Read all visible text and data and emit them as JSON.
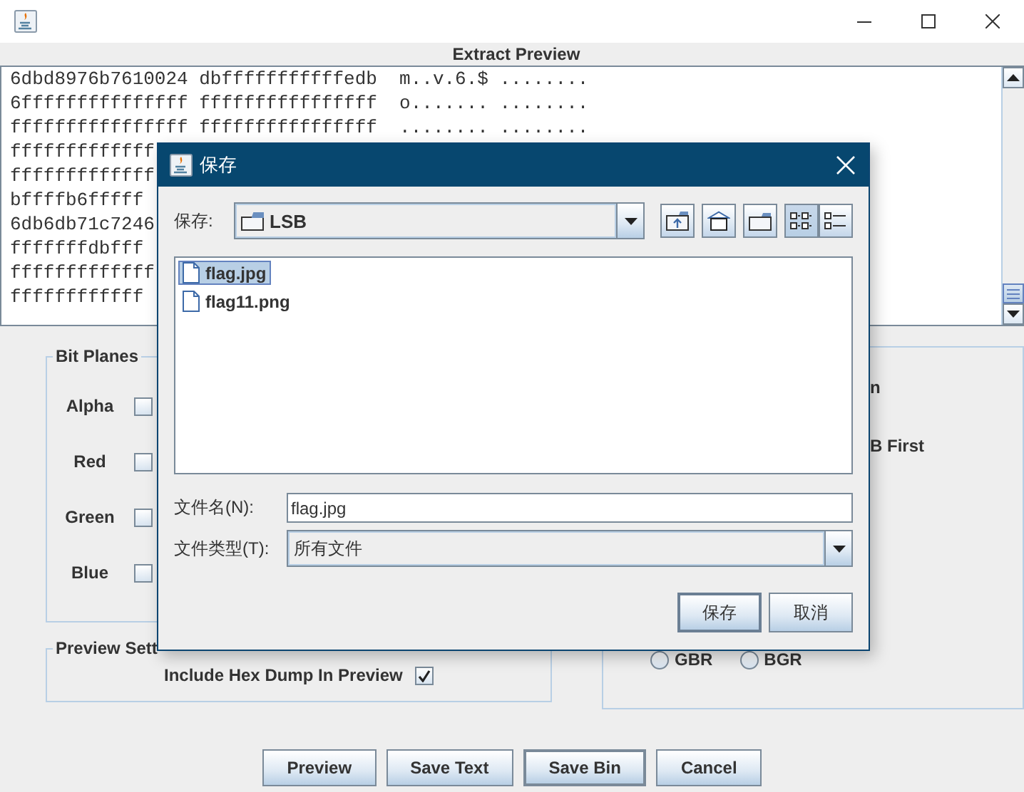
{
  "preview": {
    "title": "Extract Preview",
    "lines": [
      "6dbd8976b7610024 dbfffffffffffedb  m..v.6.$ ........",
      "6fffffffffffffff ffffffffffffffff  o....... ........",
      "ffffffffffffffff ffffffffffffffff  ........ ........",
      "fffffffffffff",
      "fffffffffffff",
      "bffffb6fffff",
      "6db6db71c7246",
      "fffffffdbfff",
      "fffffffffffff",
      "ffffffffffff"
    ]
  },
  "bit_planes": {
    "title": "Bit Planes",
    "rows": [
      {
        "label": "Alpha",
        "checked": false
      },
      {
        "label": "Red",
        "checked": false
      },
      {
        "label": "Green",
        "checked": false
      },
      {
        "label": "Blue",
        "checked": false
      }
    ]
  },
  "right_panel": {
    "texts": [
      "n",
      "B First"
    ],
    "radios": [
      {
        "label": "GBR",
        "selected": false
      },
      {
        "label": "BGR",
        "selected": false
      }
    ]
  },
  "preview_settings": {
    "title": "Preview Sett",
    "options": [
      {
        "label": "Include Hex Dump In Preview",
        "checked": true
      }
    ]
  },
  "buttons": [
    {
      "label": "Preview",
      "focused": false
    },
    {
      "label": "Save Text",
      "focused": false
    },
    {
      "label": "Save Bin",
      "focused": true
    },
    {
      "label": "Cancel",
      "focused": false
    }
  ],
  "dialog": {
    "title": "保存",
    "look_in": {
      "label": "保存:",
      "value": "LSB"
    },
    "toolbar": [
      {
        "kind": "up",
        "selected": false
      },
      {
        "kind": "home",
        "selected": false
      },
      {
        "kind": "new-folder",
        "selected": false
      },
      {
        "kind": "list",
        "selected": true
      },
      {
        "kind": "details",
        "selected": false
      }
    ],
    "files": [
      {
        "name": "flag.jpg",
        "selected": true
      },
      {
        "name": "flag11.png",
        "selected": false
      }
    ],
    "file_name": {
      "label": "文件名(N):",
      "value": "flag.jpg"
    },
    "file_type": {
      "label": "文件类型(T):",
      "value": "所有文件"
    },
    "buttons": [
      {
        "label": "保存",
        "default": true
      },
      {
        "label": "取消",
        "default": false
      }
    ]
  }
}
